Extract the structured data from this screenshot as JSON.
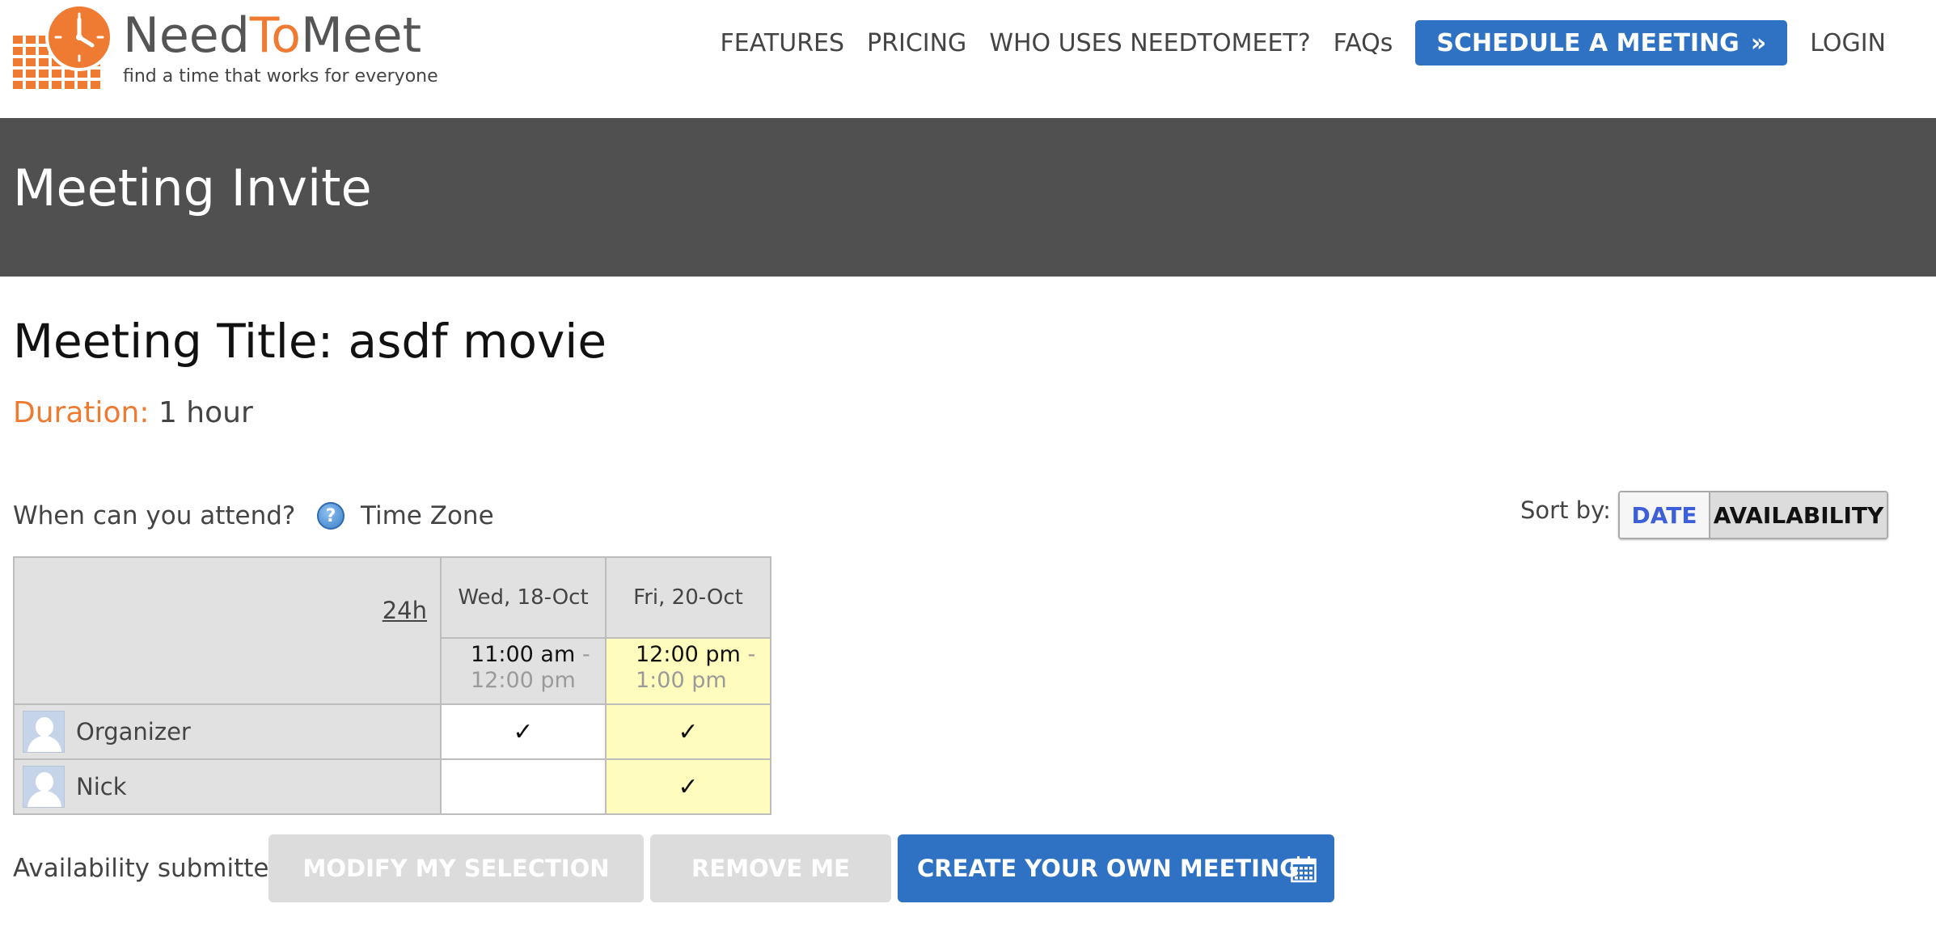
{
  "brand": {
    "name_part1": "Need",
    "name_part2": "To",
    "name_part3": "Meet",
    "tagline": "find a time that works for everyone",
    "accent_color": "#ef7a32"
  },
  "nav": {
    "features": "FEATURES",
    "pricing": "PRICING",
    "who_uses": "WHO USES NEEDTOMEET?",
    "faqs": "FAQs",
    "schedule": "SCHEDULE A MEETING",
    "schedule_icon": "double-chevron-right-icon",
    "login": "LOGIN",
    "cta_color": "#2f72c3"
  },
  "banner": {
    "title": "Meeting Invite",
    "bg_color": "#505050"
  },
  "meeting": {
    "title": "Meeting Title: asdf movie",
    "duration_label": "Duration:",
    "duration_value": "1 hour"
  },
  "availability": {
    "prompt": "When can you attend?",
    "timezone_icon": "help-icon",
    "timezone_label": "Time Zone",
    "sort_label": "Sort by:",
    "sort_options": [
      "DATE",
      "AVAILABILITY"
    ],
    "sort_selected": "AVAILABILITY",
    "toggle_24h": "24h",
    "columns": [
      {
        "day": "Wed, 18-Oct",
        "start": "11:00 am",
        "end": "12:00 pm",
        "highlight": false
      },
      {
        "day": "Fri, 20-Oct",
        "start": "12:00 pm",
        "end": "1:00 pm",
        "highlight": true
      }
    ],
    "dash": "-",
    "participants": [
      {
        "name": "Organizer",
        "marks": [
          "✓",
          "✓"
        ]
      },
      {
        "name": "Nick",
        "marks": [
          "",
          "✓"
        ]
      }
    ],
    "highlight_color": "#fffcbe"
  },
  "actions": {
    "status": "Availability submitted!",
    "modify": "MODIFY MY SELECTION",
    "remove": "REMOVE ME",
    "create": "CREATE YOUR OWN MEETING",
    "create_icon": "calendar-icon"
  }
}
